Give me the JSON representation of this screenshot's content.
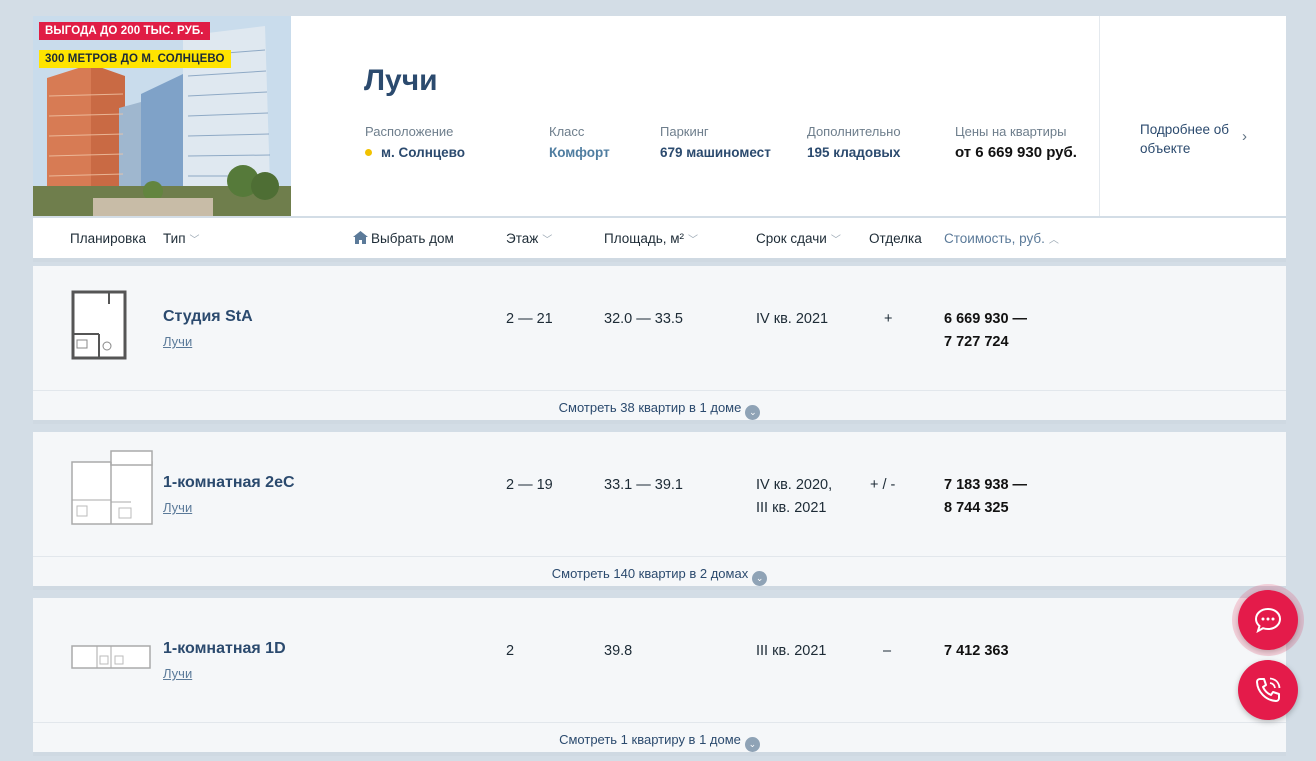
{
  "complex": {
    "badge_discount": "ВЫГОДА ДО 200 ТЫС. РУБ.",
    "badge_metro": "300 МЕТРОВ ДО М. СОЛНЦЕВО",
    "title": "Лучи",
    "location_label": "Расположение",
    "location_value": "м. Солнцево",
    "class_label": "Класс",
    "class_value": "Комфорт",
    "parking_label": "Паркинг",
    "parking_value": "679 машиномест",
    "extra_label": "Дополнительно",
    "extra_value": "195 кладовых",
    "prices_label": "Цены на квартиры",
    "prices_value": "от 6 669 930 руб.",
    "more_link": "Подробнее об объекте",
    "metro_color": "#f2c200"
  },
  "table_header": {
    "layout": "Планировка",
    "type": "Тип",
    "select_house": "Выбрать дом",
    "floor": "Этаж",
    "area": "Площадь, м²",
    "deadline": "Срок сдачи",
    "finish": "Отделка",
    "price": "Стоимость, руб."
  },
  "rows": [
    {
      "name": "Студия StA",
      "complex": "Лучи",
      "floor": "2 — 21",
      "area": "32.0  — 33.5",
      "deadline_1": "IV кв. 2021",
      "deadline_2": "",
      "finish": "+",
      "price_1": "6 669 930  —",
      "price_2": "7 727 724",
      "footer": "Смотреть 38 квартир в 1 доме"
    },
    {
      "name": "1-комнатная 2eC",
      "complex": "Лучи",
      "floor": "2 — 19",
      "area": "33.1  — 39.1",
      "deadline_1": "IV кв. 2020,",
      "deadline_2": "III кв. 2021",
      "finish": "+ / -",
      "price_1": "7 183 938  —",
      "price_2": "8 744 325",
      "footer": "Смотреть 140 квартир в 2 домах"
    },
    {
      "name": "1-комнатная 1D",
      "complex": "Лучи",
      "floor": "2",
      "area": "39.8",
      "deadline_1": "III кв. 2021",
      "deadline_2": "",
      "finish": "–",
      "price_1": "7 412 363",
      "price_2": "",
      "footer": "Смотреть 1 квартиру в 1 доме"
    }
  ],
  "icons": {
    "chat": "chat-icon",
    "call": "phone-icon",
    "house": "house-icon",
    "chevron": "chevron-down-icon"
  },
  "colors": {
    "accent_red": "#e41b4a",
    "link_blue": "#2b4a6e",
    "badge_yellow": "#ffe400"
  }
}
